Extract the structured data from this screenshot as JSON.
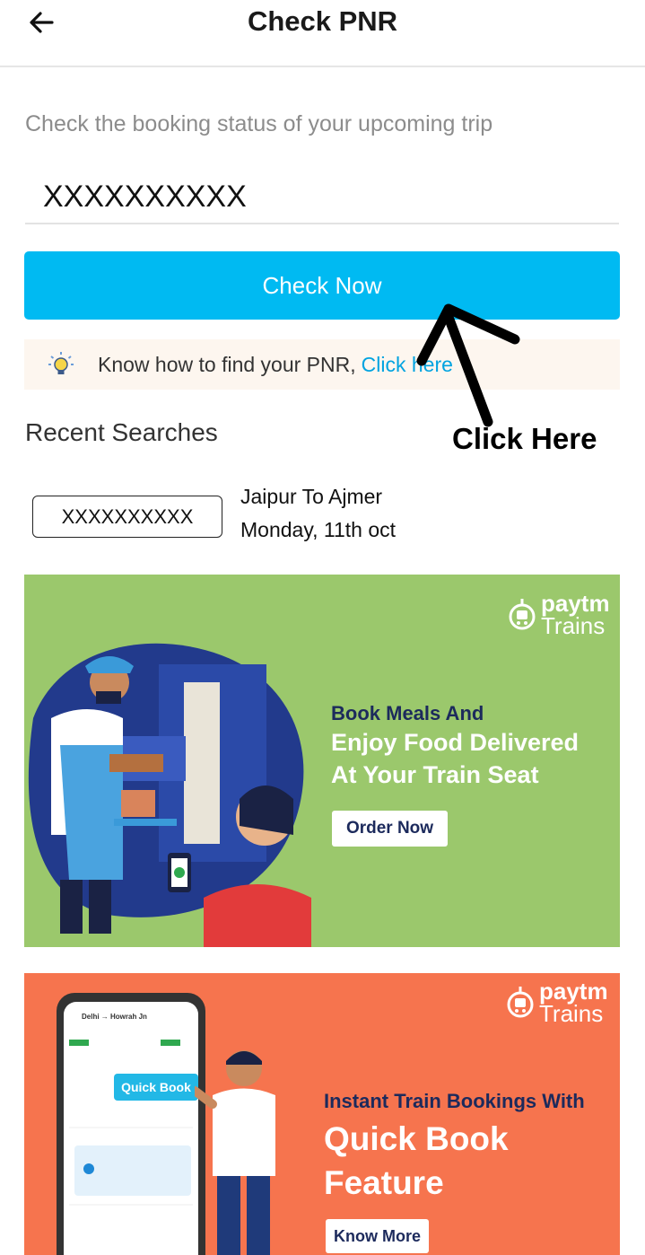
{
  "header": {
    "title": "Check PNR",
    "back_icon": "arrow-left-icon"
  },
  "form": {
    "subtitle": "Check the booking status of your upcoming trip",
    "pnr_value": "XXXXXXXXXX",
    "check_button": "Check Now",
    "accent_color": "#00baf2"
  },
  "hint": {
    "text": "Know how to find your PNR,",
    "link": "Click here",
    "icon": "lightbulb-icon"
  },
  "annotation": {
    "label": "Click Here"
  },
  "recent": {
    "title": "Recent Searches",
    "items": [
      {
        "pnr": "XXXXXXXXXX",
        "route": "Jaipur To Ajmer",
        "date": "Monday, 11th oct"
      }
    ]
  },
  "banners": [
    {
      "brand": "paytm",
      "brand_sub": "Trains",
      "line1": "Book Meals And",
      "line2": "Enjoy Food Delivered",
      "line3": "At Your Train Seat",
      "button": "Order Now",
      "bg_color": "#9bc86c"
    },
    {
      "brand": "paytm",
      "brand_sub": "Trains",
      "line1": "Instant Train Bookings With",
      "line2": "Quick Book",
      "line3": "Feature",
      "button": "Know More",
      "badge": "Quick Book",
      "phone_title": "Delhi → Howrah Jn",
      "bg_color": "#f6744e"
    }
  ]
}
